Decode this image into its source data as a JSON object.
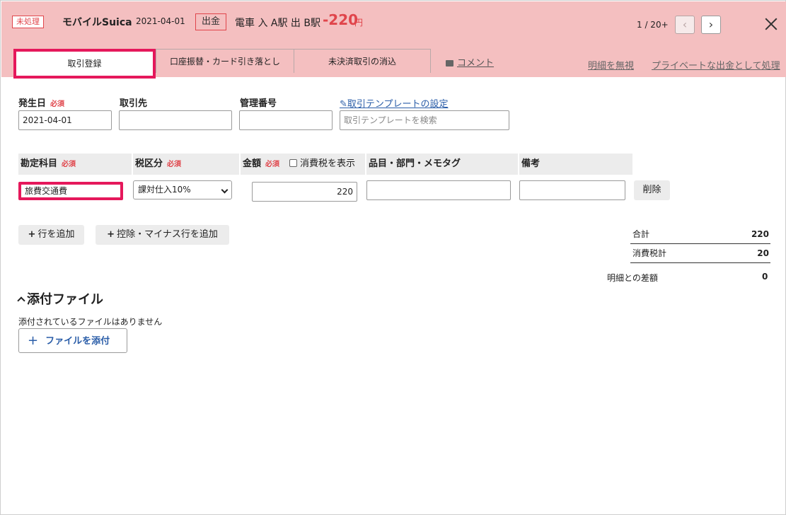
{
  "header": {
    "status_badge": "未処理",
    "account_name": "モバイルSuica",
    "date": "2021-04-01",
    "direction": "出金",
    "description": "電車 入 A駅 出 B駅",
    "amount": "-220",
    "unit": "円",
    "pager": "1 / 20+",
    "prev_icon": "‹",
    "next_icon": "›"
  },
  "tabs": [
    {
      "label": "取引登録"
    },
    {
      "label": "口座振替・カード引き落とし"
    },
    {
      "label": "未決済取引の消込"
    }
  ],
  "comment_link": "コメント",
  "header_links": {
    "ignore": "明細を無視",
    "private": "プライベートな出金として処理"
  },
  "form": {
    "date_label": "発生日",
    "required": "必須",
    "date_value": "2021-04-01",
    "partner_label": "取引先",
    "partner_value": "",
    "mgmt_label": "管理番号",
    "mgmt_value": "",
    "template_link": "取引テンプレートの設定",
    "template_placeholder": "取引テンプレートを検索"
  },
  "table": {
    "headers": {
      "account": "勘定科目",
      "tax": "税区分",
      "amount": "金額",
      "show_tax": "消費税を表示",
      "items": "品目・部門・メモタグ",
      "notes": "備考"
    },
    "row": {
      "account": "旅費交通費",
      "tax": "課対仕入10%",
      "amount": "220",
      "items": "",
      "notes": "",
      "delete": "削除"
    }
  },
  "buttons": {
    "add_row": "行を追加",
    "add_minus_row": "控除・マイナス行を追加"
  },
  "summary": {
    "total_label": "合計",
    "total_value": "220",
    "tax_label": "消費税計",
    "tax_value": "20",
    "diff_label": "明細との差額",
    "diff_value": "0"
  },
  "attachments": {
    "title": "添付ファイル",
    "empty_text": "添付されているファイルはありません",
    "attach_button": "ファイルを添付"
  }
}
